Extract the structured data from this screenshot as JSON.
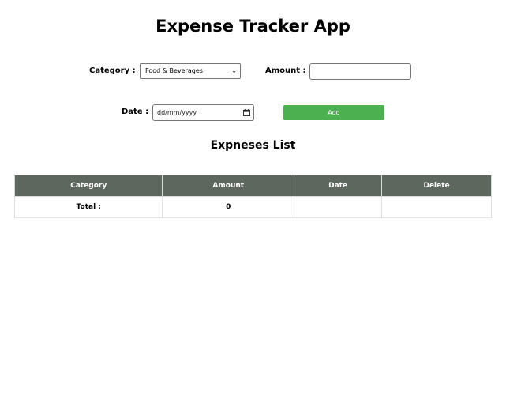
{
  "app": {
    "title": "Expense Tracker App"
  },
  "form": {
    "category_label": "Category :",
    "category_selected": "Food & Beverages",
    "amount_label": "Amount :",
    "amount_value": "",
    "date_label": "Date :",
    "date_placeholder": "dd/mm/yyyy",
    "add_label": "Add",
    "add_color": "#4caf50"
  },
  "list": {
    "title": "Expneses List",
    "header_color": "#5d675d",
    "columns": [
      "Category",
      "Amount",
      "Date",
      "Delete"
    ],
    "total_label": "Total :",
    "total_value": "0"
  }
}
